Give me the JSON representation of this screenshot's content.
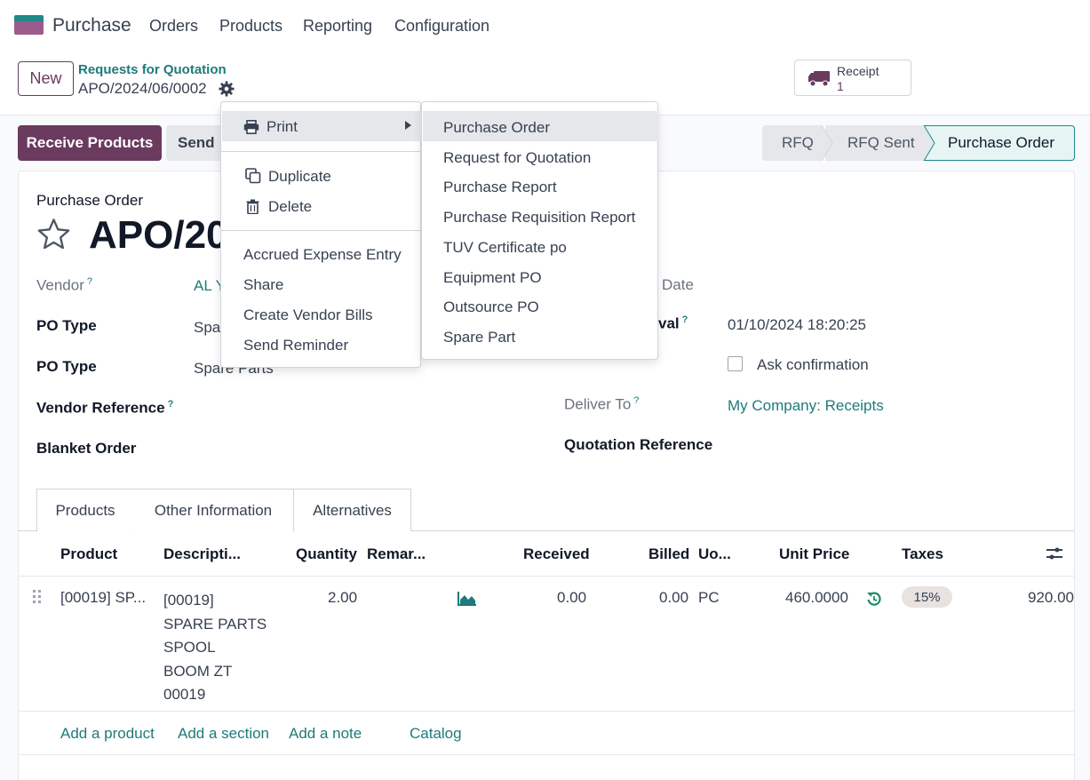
{
  "navbar": {
    "app_name": "Purchase",
    "menu": [
      "Orders",
      "Products",
      "Reporting",
      "Configuration"
    ]
  },
  "control": {
    "new_label": "New",
    "breadcrumb_parent": "Requests for Quotation",
    "breadcrumb_current": "APO/2024/06/0002",
    "receipt_label": "Receipt",
    "receipt_count": "1"
  },
  "actions": {
    "receive_products": "Receive Products",
    "send_partial": "Send"
  },
  "statusbar": [
    "RFQ",
    "RFQ Sent",
    "Purchase Order"
  ],
  "form": {
    "type_label": "Purchase Order",
    "name_partial": "APO/20",
    "vendor_label": "Vendor",
    "vendor_value": "AL Y",
    "po_type1_label": "PO Type",
    "po_type1_value": "Spa",
    "po_type2_label": "PO Type",
    "po_type2_value": "Spare Parts",
    "vendor_ref_label": "Vendor Reference",
    "blanket_label": "Blanket Order",
    "date_label_partial": "Date",
    "approval_label_partial": "val",
    "approval_value": "01/10/2024 18:20:25",
    "ask_confirmation": "Ask confirmation",
    "deliver_to_label": "Deliver To",
    "deliver_to_value": "My Company: Receipts",
    "quotation_ref_label": "Quotation Reference",
    "help_mark": "?"
  },
  "tabs": [
    "Products",
    "Other Information",
    "Alternatives"
  ],
  "table": {
    "headers": [
      "Product",
      "Descripti...",
      "Quantity",
      "Remar...",
      "Received",
      "Billed",
      "Uo...",
      "Unit Price",
      "Taxes"
    ],
    "row": {
      "product": "[00019] SP...",
      "description": [
        "[00019]",
        "SPARE PARTS",
        "SPOOL",
        "BOOM ZT",
        "00019"
      ],
      "quantity": "2.00",
      "received": "0.00",
      "billed": "0.00",
      "uom": "PC",
      "unit_price": "460.0000",
      "tax": "15%",
      "subtotal": "920.00"
    },
    "footer_links": [
      "Add a product",
      "Add a section",
      "Add a note",
      "Catalog"
    ]
  },
  "action_menu": {
    "print": "Print",
    "duplicate": "Duplicate",
    "delete": "Delete",
    "others": [
      "Accrued Expense Entry",
      "Share",
      "Create Vendor Bills",
      "Send Reminder"
    ]
  },
  "print_menu": [
    "Purchase Order",
    "Request for Quotation",
    "Purchase Report",
    "Purchase Requisition Report",
    "TUV Certificate po",
    "Equipment PO",
    "Outsource PO",
    "Spare Part"
  ],
  "colors": {
    "brand": "#6b3a5f",
    "link": "#1f7a7a",
    "highlight": "#e5e7eb"
  }
}
